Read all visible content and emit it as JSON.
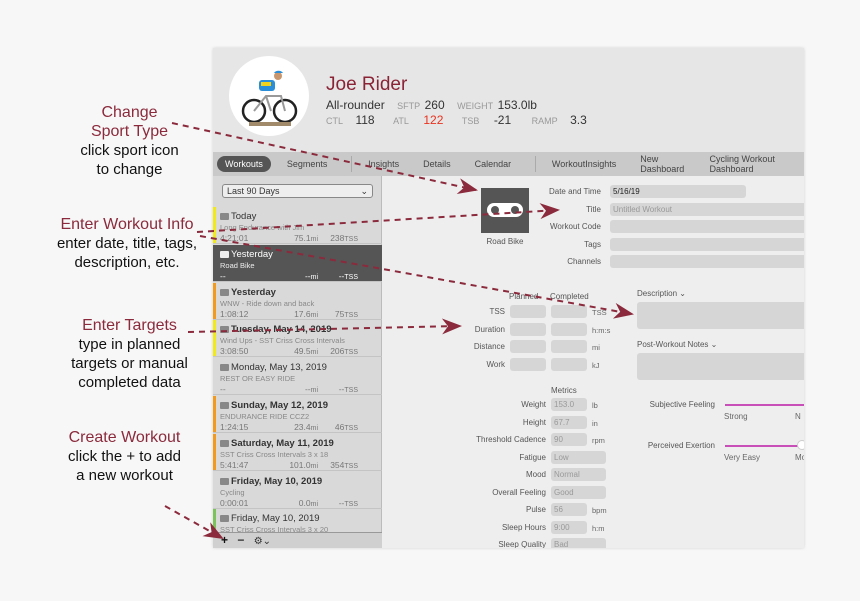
{
  "annotations": [
    {
      "title": [
        "Change",
        "Sport Type"
      ],
      "body": [
        "click sport icon",
        "to change"
      ]
    },
    {
      "title": [
        "Enter Workout Info"
      ],
      "body": [
        "enter date, title, tags,",
        "description, etc."
      ]
    },
    {
      "title": [
        "Enter Targets"
      ],
      "body": [
        "type in planned",
        "targets or manual",
        "completed data"
      ]
    },
    {
      "title": [
        "Create Workout"
      ],
      "body": [
        "click the + to add",
        "a new workout"
      ]
    }
  ],
  "colors": {
    "accent": "#8b2336",
    "atl": "#e8321e",
    "arrow": "#8b2a3c",
    "slider": "#c94fb8"
  },
  "profile": {
    "name": "Joe Rider",
    "type": "All-rounder",
    "sftp_label": "SFTP",
    "sftp": "260",
    "weight_label": "WEIGHT",
    "weight": "153.0",
    "weight_unit": "lb",
    "ctl_label": "CTL",
    "ctl": "118",
    "atl_label": "ATL",
    "atl": "122",
    "tsb_label": "TSB",
    "tsb": "-21",
    "ramp_label": "RAMP",
    "ramp": "3.3"
  },
  "tabs": [
    "Workouts",
    "Segments",
    "Insights",
    "Details",
    "Calendar",
    "WorkoutInsights",
    "New Dashboard",
    "Cycling Workout Dashboard"
  ],
  "sidebar": {
    "range": "Last 90 Days",
    "items": [
      {
        "title": "Today",
        "bold": false,
        "sub": "Long Endurance with Jim",
        "time": "4:21:01",
        "dist": "75.1",
        "tss": "238",
        "color": "#f1e91a"
      },
      {
        "title": "Yesterday",
        "bold": false,
        "sub": "Road Bike",
        "time": "--",
        "dist": "--",
        "tss": "--",
        "color": "",
        "selected": true
      },
      {
        "title": "Yesterday",
        "bold": true,
        "sub": "WNW - Ride down and back",
        "time": "1:08:12",
        "dist": "17.6",
        "tss": "75",
        "color": "#f39a1e"
      },
      {
        "title": "Tuesday, May 14, 2019",
        "bold": true,
        "sub": "Wind Ups - SST Criss Cross Intervals",
        "time": "3:08:50",
        "dist": "49.5",
        "tss": "206",
        "color": "#f1e91a"
      },
      {
        "title": "Monday, May 13, 2019",
        "bold": false,
        "sub": "REST OR EASY RIDE",
        "time": "--",
        "dist": "--",
        "tss": "--",
        "color": ""
      },
      {
        "title": "Sunday, May 12, 2019",
        "bold": true,
        "sub": "ENDURANCE RIDE CCZ2",
        "time": "1:24:15",
        "dist": "23.4",
        "tss": "46",
        "color": "#f39a1e"
      },
      {
        "title": "Saturday, May 11, 2019",
        "bold": true,
        "sub": "SST Criss Cross Intervals 3 x 18",
        "time": "5:41:47",
        "dist": "101.0",
        "tss": "354",
        "color": "#f39a1e"
      },
      {
        "title": "Friday, May 10, 2019",
        "bold": true,
        "sub": "Cycling",
        "time": "0:00:01",
        "dist": "0.0",
        "tss": "--",
        "color": ""
      },
      {
        "title": "Friday, May 10, 2019",
        "bold": false,
        "sub": "SST Criss Cross Intervals 3 x 20",
        "time": "",
        "dist": "",
        "tss": "",
        "color": "#7dc35b"
      }
    ],
    "mi": "mi",
    "tss_unit": "TSS",
    "add": "+",
    "remove": "−",
    "gear": "⚙⌄"
  },
  "detail": {
    "sport": "Road Bike",
    "fields": [
      {
        "label": "Date and Time",
        "value": "5/16/19"
      },
      {
        "label": "Title",
        "value": "",
        "placeholder": "Untitled Workout"
      },
      {
        "label": "Workout Code",
        "value": ""
      },
      {
        "label": "Tags",
        "value": ""
      },
      {
        "label": "Channels",
        "value": ""
      }
    ],
    "planned": "Planned",
    "completed": "Completed",
    "targets": [
      {
        "label": "TSS",
        "unit": "TSS"
      },
      {
        "label": "Duration",
        "unit": "h:m:s"
      },
      {
        "label": "Distance",
        "unit": "mi"
      },
      {
        "label": "Work",
        "unit": "kJ"
      }
    ],
    "description": "Description ⌄",
    "notes": "Post-Workout Notes ⌄",
    "metrics_title": "Metrics",
    "metrics": [
      {
        "label": "Weight",
        "value": "153.0",
        "unit": "lb"
      },
      {
        "label": "Height",
        "value": "67.7",
        "unit": "in"
      },
      {
        "label": "Threshold Cadence",
        "value": "90",
        "unit": "rpm"
      },
      {
        "label": "Fatigue",
        "value": "Low",
        "unit": ""
      },
      {
        "label": "Mood",
        "value": "Normal",
        "unit": ""
      },
      {
        "label": "Overall Feeling",
        "value": "Good",
        "unit": ""
      },
      {
        "label": "Pulse",
        "value": "56",
        "unit": "bpm"
      },
      {
        "label": "Sleep Hours",
        "value": "9:00",
        "unit": "h:m"
      },
      {
        "label": "Sleep Quality",
        "value": "Bad",
        "unit": ""
      }
    ],
    "subjective": {
      "label": "Subjective Feeling",
      "min": "Strong",
      "next": "N"
    },
    "exertion": {
      "label": "Perceived Exertion",
      "min": "Very Easy",
      "next": "Mo"
    }
  }
}
